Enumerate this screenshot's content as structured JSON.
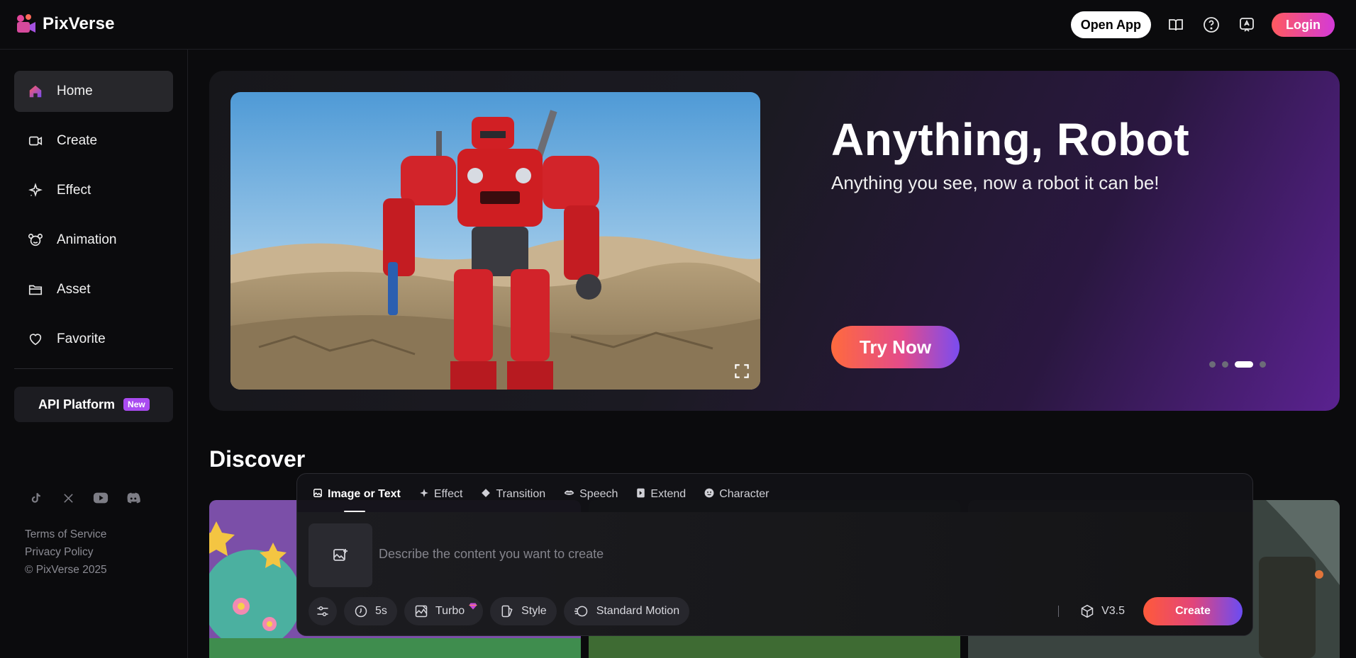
{
  "header": {
    "logo_text": "PixVerse",
    "open_app_label": "Open App",
    "login_label": "Login",
    "icons": [
      "book-icon",
      "help-icon",
      "feedback-icon"
    ]
  },
  "sidebar": {
    "items": [
      {
        "label": "Home",
        "icon": "home-icon",
        "active": true
      },
      {
        "label": "Create",
        "icon": "video-camera-icon"
      },
      {
        "label": "Effect",
        "icon": "sparkle-icon"
      },
      {
        "label": "Animation",
        "icon": "mascot-icon"
      },
      {
        "label": "Asset",
        "icon": "folder-icon"
      },
      {
        "label": "Favorite",
        "icon": "heart-icon"
      }
    ],
    "api_label": "API Platform",
    "api_badge": "New",
    "socials": [
      "tiktok-icon",
      "x-icon",
      "youtube-icon",
      "discord-icon"
    ],
    "footer": {
      "terms": "Terms of Service",
      "privacy": "Privacy Policy",
      "copyright": "© PixVerse 2025"
    }
  },
  "banner": {
    "title": "Anything, Robot",
    "subtitle": "Anything you see, now a robot it can be!",
    "cta_label": "Try Now",
    "carousel_count": 4,
    "carousel_active": 3
  },
  "discover": {
    "title": "Discover"
  },
  "composer": {
    "tabs": [
      {
        "label": "Image or Text",
        "icon": "image-icon",
        "active": true
      },
      {
        "label": "Effect",
        "icon": "sparkle-icon"
      },
      {
        "label": "Transition",
        "icon": "transition-icon"
      },
      {
        "label": "Speech",
        "icon": "lips-icon"
      },
      {
        "label": "Extend",
        "icon": "extend-icon"
      },
      {
        "label": "Character",
        "icon": "face-icon"
      }
    ],
    "placeholder": "Describe the content you want to create",
    "duration": "5s",
    "quality": "Turbo",
    "style": "Style",
    "motion": "Standard Motion",
    "model": "V3.5",
    "create_label": "Create"
  },
  "colors": {
    "accent_gradient_start": "#ff5a3a",
    "accent_gradient_end": "#6b4cf3",
    "login_gradient": "#d43ad8",
    "badge_purple": "#a94bf0"
  }
}
